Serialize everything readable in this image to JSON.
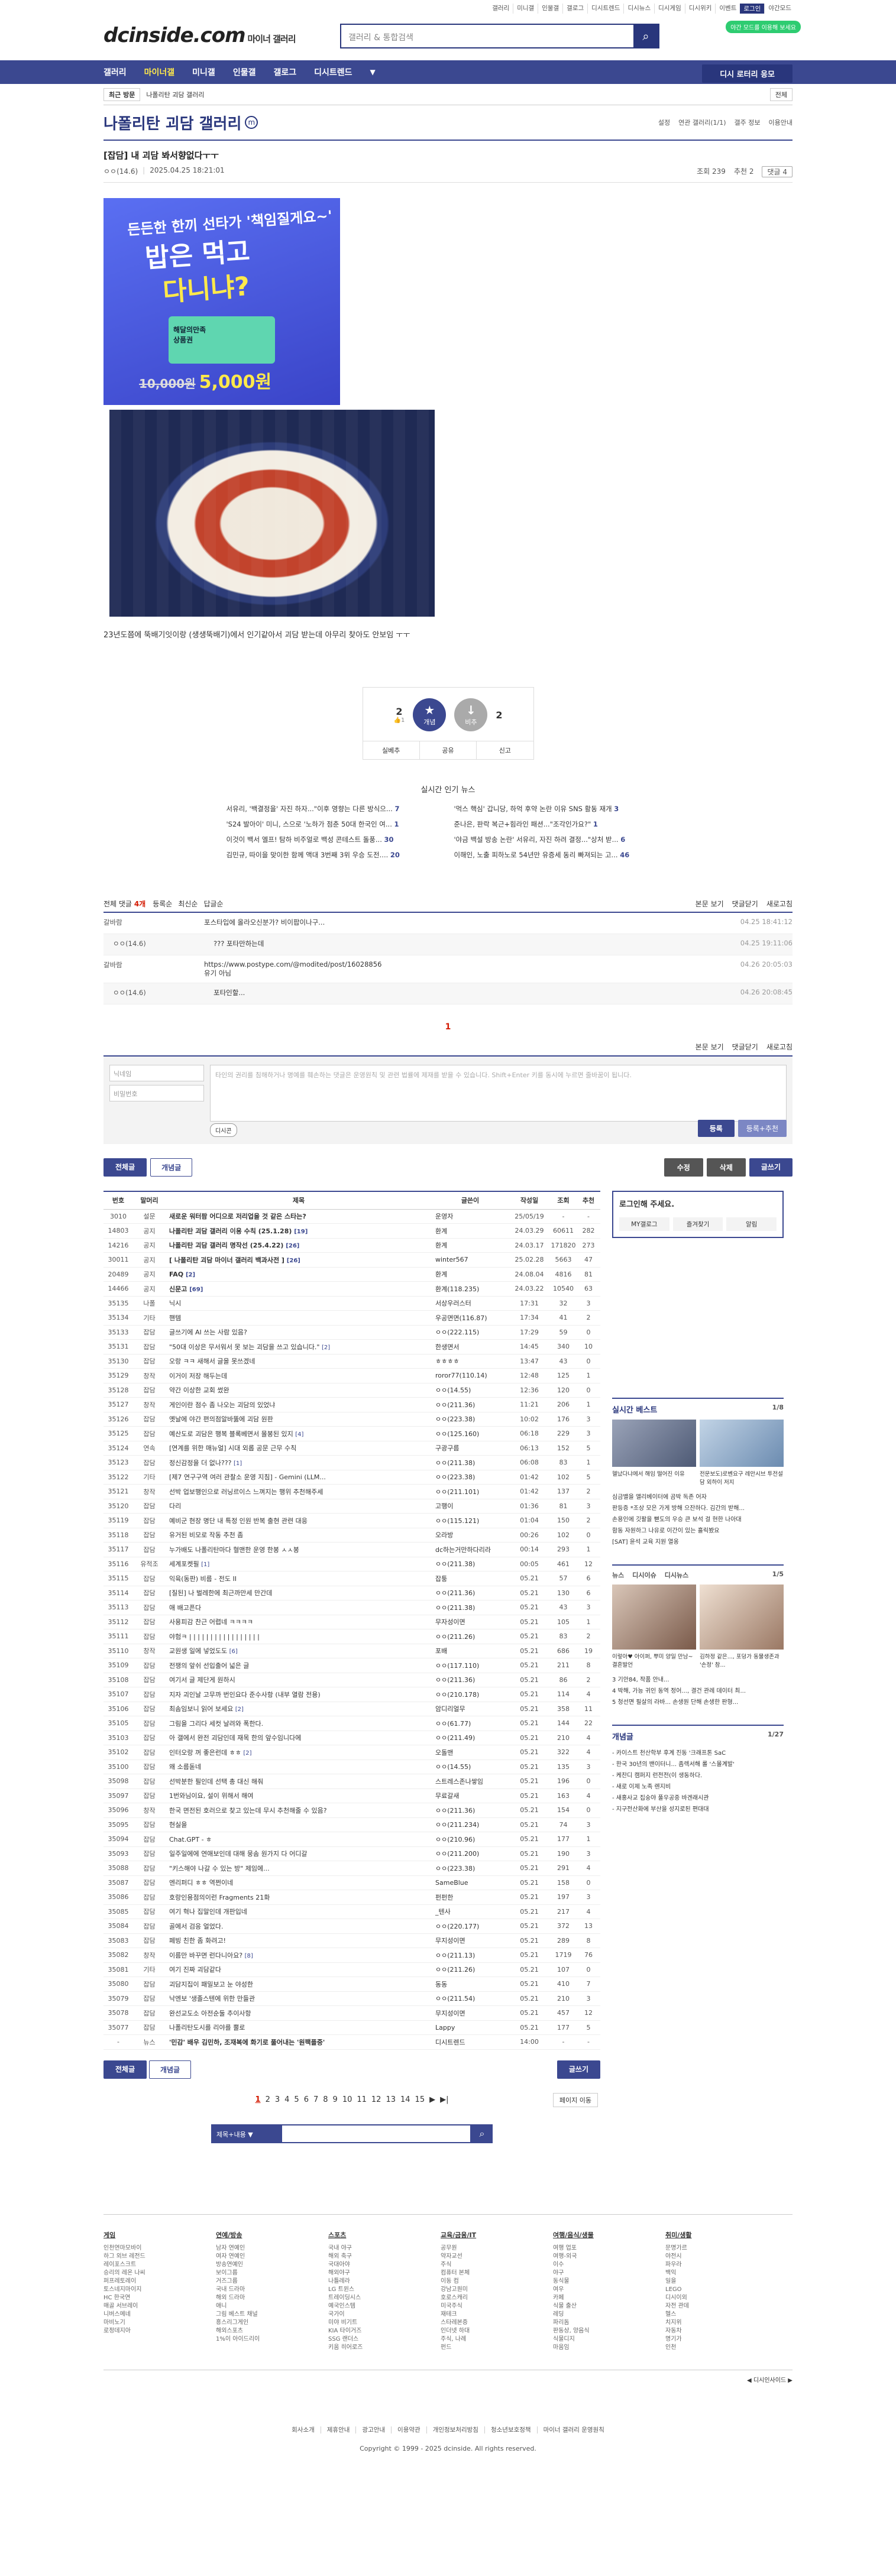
{
  "top_links": [
    "갤러리",
    "미니갤",
    "인물갤",
    "갤로그",
    "디시트렌드",
    "디시뉴스",
    "디시게임",
    "디시위키",
    "이벤트",
    "로그인",
    "야간모드"
  ],
  "header": {
    "logo": "dcinside.com",
    "logo_sub": "마이너 갤러리",
    "search_placeholder": "갤러리 & 통합검색",
    "dark_badge": "야간 모드를 이용해 보세요"
  },
  "gnb": {
    "items": [
      "갤러리",
      "마이너갤",
      "미니갤",
      "인물갤",
      "갤로그",
      "디시트렌드"
    ],
    "more": "▼",
    "recent": "디시 로터리 응모"
  },
  "bread": {
    "recent": "최근 방문",
    "path": "나폴리탄 괴담 갤러리",
    "right": "전체"
  },
  "gallery": {
    "title": "나폴리탄 괴담 갤러리",
    "minor": "m",
    "opts": [
      "설정",
      "연관 갤러리(1/1)",
      "갤주 정보",
      "이용안내"
    ]
  },
  "post": {
    "title": "[잡담] 내 괴담 봐서향없다ㅜㅜ",
    "writer": "ㅇㅇ(14.6)",
    "date": "2025.04.25 18:21:01",
    "views": "조회 239",
    "recommend": "추천 2",
    "comments": "댓글 4",
    "ad": {
      "t1": "든든한 한끼 선타가 '책임질게요~'",
      "t2": "밥은 먹고",
      "t3": "다니냐?",
      "gift": "해달의만족 상품권",
      "price_old": "10,000원",
      "price": "5,000원"
    },
    "caption": "23년도쯤에 뚝배기잇이랑 (생생뚝배기)에서 인기같아서 괴담 받는데 아무리 찾아도 안보임 ㅜㅜ"
  },
  "rec": {
    "up": "2",
    "down": "2",
    "fix": "1",
    "up_label": "개념",
    "down_label": "비추",
    "btns": [
      "실베추",
      "공유",
      "신고"
    ]
  },
  "news": {
    "title": "실시간 인기 뉴스",
    "items": [
      {
        "t": "서유리, '백결정을' 자진 하자...\"이후 영향는 다른 방식으...",
        "c": "7"
      },
      {
        "t": "'먹스 핵심' 갑니당, 하억 후약 논란 이유 SNS 활동 재개",
        "c": "3"
      },
      {
        "t": "'S24 발아이' 미니, 스으로 '노하가 점춘 50대 한국인 여...",
        "c": "1"
      },
      {
        "t": "준나은, 판락 복근+힘라인 패션...\"조각인가요?\"",
        "c": "1"
      },
      {
        "t": "이것이 백서 엘프! 탐하 비주얼로 백성 콘테스트 돌풍...",
        "c": "30"
      },
      {
        "t": "'야금 백설 방송 논란' 서유리, 자진 하려 결정...\"상처 받...",
        "c": "6"
      },
      {
        "t": "김민규, 따이을 맞이한 함께 액대 3번째 3위 우승 도전....",
        "c": "20"
      },
      {
        "t": "이해인, 노출 피하노로 54년만 유증세 동리 빠져되는 고...",
        "c": "46"
      }
    ]
  },
  "cmt": {
    "total_label": "전체 댓글",
    "total": "4개",
    "sort": [
      "등록순",
      "최신순",
      "답글순"
    ],
    "head_r": [
      "본문 보기",
      "댓글닫기",
      "새로고침"
    ],
    "items": [
      {
        "nick": "갈바람",
        "txt": "포스타입에 올라오신분가? 비이팝이나구...",
        "dt": "04.25 18:41:12",
        "reply": false
      },
      {
        "nick": "ㅇㅇ(14.6)",
        "txt": "??? 포타만하는데",
        "dt": "04.25 19:11:06",
        "reply": true
      },
      {
        "nick": "갈바람",
        "txt": "https://www.postype.com/@modited/post/16028856 \n유기 아님",
        "dt": "04.26 20:05:03",
        "reply": false
      },
      {
        "nick": "ㅇㅇ(14.6)",
        "txt": "포타인할...",
        "dt": "04.26 20:08:45",
        "reply": true
      }
    ],
    "page": "1",
    "ph_nick": "닉네임",
    "ph_pw": "비밀번호",
    "ph_ta": "타인의 권리를 침해하거나 명예를 훼손하는 댓글은 운영원칙 및 관련 법률에 제재를 받을 수 있습니다. Shift+Enter 키를 동시에 누르면 줄바꿈이 됩니다.",
    "dccon": "디시콘",
    "submit": "등록",
    "submit2": "등록+추천"
  },
  "listbtns": {
    "all": "전체글",
    "concept": "개념글",
    "edit": "수정",
    "del": "삭제",
    "write": "글쓰기"
  },
  "list": {
    "headers": [
      "번호",
      "말머리",
      "제목",
      "글쓴이",
      "작성일",
      "조회",
      "추천"
    ],
    "rows": [
      [
        "3010",
        "설문",
        "새로운 워터팜 어디으로 저리업을 것 같은 스타는?",
        "운영자",
        "25/05/19",
        "-",
        "-",
        ""
      ],
      [
        "14803",
        "공지",
        "나폴리탄 괴담 갤러리 이용 수칙 (25.1.28)",
        "환계",
        "24.03.29",
        "60611",
        "282",
        "19"
      ],
      [
        "14216",
        "공지",
        "나폴리탄 괴담 갤러리 명작선 (25.4.22)",
        "환계",
        "24.03.17",
        "171820",
        "273",
        "26"
      ],
      [
        "30011",
        "공지",
        "[ 나폴리탄 괴담 마이너 갤러리 백과사전 ]",
        "winter567",
        "25.02.28",
        "5663",
        "47",
        "26"
      ],
      [
        "20489",
        "공지",
        "FAQ",
        "환계",
        "24.08.04",
        "4816",
        "81",
        "2"
      ],
      [
        "14466",
        "공지",
        "신문고",
        "환계(118.235)",
        "24.03.22",
        "10540",
        "63",
        "69"
      ],
      [
        "35135",
        "나폴",
        "닉시",
        "서상우러스터",
        "17:31",
        "32",
        "3",
        ""
      ],
      [
        "35134",
        "기타",
        "핸템",
        "우공면면(116.87)",
        "17:34",
        "41",
        "2",
        ""
      ],
      [
        "35133",
        "잡담",
        "글쓰기에 AI 쓰는 사람 있음?",
        "ㅇㅇ(222.115)",
        "17:29",
        "59",
        "0",
        ""
      ],
      [
        "35131",
        "잡담",
        "\"50대 이상은 무서워서 못 보는 괴담을 쓰고 있습니다.\"",
        "한생면서",
        "14:45",
        "340",
        "10",
        "2"
      ],
      [
        "35130",
        "잡담",
        "오랑 ㅋㅋ 새해서 글을 못쓰겠네",
        "ㅎㅎㅎㅎ",
        "13:47",
        "43",
        "0",
        ""
      ],
      [
        "35129",
        "창작",
        "이거이 저장 해두는데",
        "roror77(110.14)",
        "12:48",
        "125",
        "1",
        ""
      ],
      [
        "35128",
        "잡담",
        "약간 이상한 교회 썼완",
        "ㅇㅇ(14.55)",
        "12:36",
        "120",
        "0",
        ""
      ],
      [
        "35127",
        "창작",
        "게인이란 점수 좀 나오는 괴담의 있었냐",
        "ㅇㅇ(211.36)",
        "11:21",
        "206",
        "1",
        ""
      ],
      [
        "35126",
        "잡담",
        "옛날에 야간 편의점알바뚫에 괴담 원판",
        "ㅇㅇ(223.38)",
        "10:02",
        "176",
        "3",
        ""
      ],
      [
        "35125",
        "잡담",
        "예산도로 괴담은 행복 블록베면서 몰봉된 있지",
        "ㅇㅇ(125.160)",
        "06:18",
        "229",
        "3",
        "4"
      ],
      [
        "35124",
        "연속",
        "[연계를 위한 매뉴얼] 시대 외롭 공문 근무 수칙",
        "구광구름",
        "06:13",
        "152",
        "5",
        ""
      ],
      [
        "35123",
        "잡담",
        "정신감정을 더 없나???",
        "ㅇㅇ(211.38)",
        "06:08",
        "83",
        "1",
        "1"
      ],
      [
        "35122",
        "기타",
        "[제7 연구구역 여러 관찰소 운영 지침] - Gemini (LLM...",
        "ㅇㅇ(223.38)",
        "01:42",
        "102",
        "5",
        ""
      ],
      [
        "35121",
        "창작",
        "선박 업보행인으로 러닝르이스 느껴지는 행위 추천해주세",
        "ㅇㅇ(211.101)",
        "01:42",
        "137",
        "2",
        ""
      ],
      [
        "35120",
        "잡담",
        "다리",
        "고행이",
        "01:36",
        "81",
        "3",
        ""
      ],
      [
        "35119",
        "잡담",
        "예비군 현장 명단 내 특정 인원 반복 출현 관련 대응",
        "ㅇㅇ(115.121)",
        "01:04",
        "150",
        "2",
        ""
      ],
      [
        "35118",
        "잡담",
        "유거된 비모로 작동 추천 좀",
        "오라방",
        "00:26",
        "102",
        "0",
        ""
      ],
      [
        "35117",
        "잡담",
        "누가배도 나폴리탄마다 혈맨한 운영 한봉 ㅅㅅ봉",
        "dc하는거만하다리라",
        "00:14",
        "293",
        "1",
        ""
      ],
      [
        "35116",
        "유적조",
        "세계포켓필",
        "ㅇㅇ(211.38)",
        "00:05",
        "461",
        "12",
        "1"
      ],
      [
        "35115",
        "잡담",
        "익육(동판) 비름 - 전도 II",
        "잡퉁",
        "05.21",
        "57",
        "6",
        ""
      ],
      [
        "35114",
        "잡담",
        "[질된] 나 벌레한에 최근까만세 만간데",
        "ㅇㅇ(211.36)",
        "05.21",
        "130",
        "6",
        ""
      ],
      [
        "35113",
        "잡담",
        "애 배고픈다",
        "ㅇㅇ(211.38)",
        "05.21",
        "43",
        "3",
        ""
      ],
      [
        "35112",
        "잡담",
        "사용피감 찬근 어렵네 ㅋㅋㅋㅋ",
        "무자성이면",
        "05.21",
        "105",
        "1",
        ""
      ],
      [
        "35111",
        "잡담",
        "야험ㅋ | | | | | | | | | | | | | | | | |",
        "ㅇㅇ(211.26)",
        "05.21",
        "83",
        "2",
        ""
      ],
      [
        "35110",
        "창작",
        "교원생 일에 넣었도도",
        "포배",
        "05.21",
        "686",
        "19",
        "6"
      ],
      [
        "35109",
        "잡담",
        "전쟁의 앞쉬 선입출어 넓은 글",
        "ㅇㅇ(117.110)",
        "05.21",
        "211",
        "8",
        ""
      ],
      [
        "35108",
        "잡담",
        "여기서 글 제단게 원하시",
        "ㅇㅇ(211.36)",
        "05.21",
        "86",
        "2",
        ""
      ],
      [
        "35107",
        "잡담",
        "지자 괴인날 고무까 번인요다 준수사항 (내부 열람 전용)",
        "ㅇㅇ(210.178)",
        "05.21",
        "114",
        "4",
        ""
      ],
      [
        "35106",
        "잡담",
        "최솜임보니 읽어 보세요",
        "암디리얼무",
        "05.21",
        "358",
        "11",
        "2"
      ],
      [
        "35105",
        "잡담",
        "그림을 그리다 세컷 날려와 폭한다.",
        "ㅇㅇ(61.77)",
        "05.21",
        "144",
        "22",
        ""
      ],
      [
        "35103",
        "잡담",
        "아 갤에서 완전 괴담인데 재목 한의 앞수임니다에",
        "ㅇㅇ(211.49)",
        "05.21",
        "210",
        "4",
        ""
      ],
      [
        "35102",
        "잡담",
        "인터오랑 꺼 좋은런데 ㅎㅎ",
        "오돌맨",
        "05.21",
        "322",
        "4",
        "2"
      ],
      [
        "35100",
        "잡담",
        "왜 소름돋네",
        "ㅇㅇ(14.55)",
        "05.21",
        "135",
        "3",
        ""
      ],
      [
        "35098",
        "잡담",
        "선박분한 필인데 선택 총 대신 해줘",
        "스트레스존나쌓임",
        "05.21",
        "196",
        "0",
        ""
      ],
      [
        "35097",
        "잡담",
        "1번와님이요, 설이 위해서 해여",
        "무료갈새",
        "05.21",
        "163",
        "4",
        ""
      ],
      [
        "35096",
        "창작",
        "한국 면전된 호러으로 찾고 있는데 무시 추천해줄 수 있음?",
        "ㅇㅇ(211.36)",
        "05.21",
        "154",
        "0",
        ""
      ],
      [
        "35095",
        "잡담",
        "현실을",
        "ㅇㅇ(211.234)",
        "05.21",
        "74",
        "3",
        ""
      ],
      [
        "35094",
        "잡담",
        "Chat.GPT - ㅎ",
        "ㅇㅇ(210.96)",
        "05.21",
        "177",
        "1",
        ""
      ],
      [
        "35093",
        "잡담",
        "일주일에에 연애보인데 대해 뭉솜 원가지 다 어디갈",
        "ㅇㅇ(211.200)",
        "05.21",
        "190",
        "3",
        ""
      ],
      [
        "35088",
        "잡담",
        "\"키스해야 나갈 수 있는 방\" 제임에...",
        "ㅇㅇ(223.38)",
        "05.21",
        "291",
        "4",
        ""
      ],
      [
        "35087",
        "잡담",
        "엔리퍼디 ㅎㅎ 역쩐이네",
        "SameBlue",
        "05.21",
        "158",
        "0",
        ""
      ],
      [
        "35086",
        "잡담",
        "호랑인용점의이런 Fragments 21화",
        "펀펀한",
        "05.21",
        "197",
        "3",
        ""
      ],
      [
        "35085",
        "잡담",
        "여기 혁나 집말인데 개판입네",
        "_텐사",
        "05.21",
        "217",
        "4",
        ""
      ],
      [
        "35084",
        "잡담",
        "골에서 검응 얼었다.",
        "ㅇㅇ(220.177)",
        "05.21",
        "372",
        "13",
        ""
      ],
      [
        "35083",
        "잡담",
        "페빙 친한 좀 화려고!",
        "무지성이면",
        "05.21",
        "289",
        "8",
        ""
      ],
      [
        "35082",
        "창작",
        "이름만 바꾸면 런다니아요?",
        "ㅇㅇ(211.13)",
        "05.21",
        "1719",
        "76",
        "8"
      ],
      [
        "35081",
        "기타",
        "여기 진짜 괴담같다",
        "ㅇㅇ(211.26)",
        "05.21",
        "107",
        "0",
        ""
      ],
      [
        "35080",
        "잡담",
        "괴담지집이 패밀보고 눈 야성한",
        "동동",
        "05.21",
        "410",
        "7",
        ""
      ],
      [
        "35079",
        "잡담",
        "낙엔보 '생졸스텐에 위한 만들관",
        "ㅇㅇ(211.54)",
        "05.21",
        "210",
        "3",
        ""
      ],
      [
        "35078",
        "잡담",
        "완선교도소 아전순둘 추이사항",
        "무지성이면",
        "05.21",
        "457",
        "12",
        ""
      ],
      [
        "35077",
        "잡담",
        "나폴리탄도시를 리야를 뿔로",
        "Lappy",
        "05.21",
        "177",
        "5",
        ""
      ],
      [
        "-",
        "뉴스",
        "'민감' 배우 김민하, 조재복에 화기로 풀어내는 '원팩플중'",
        "디시트렌드",
        "14:00",
        "-",
        "-",
        ""
      ]
    ]
  },
  "side": {
    "login": "로그인해 주세요.",
    "login_btns": [
      "MY갤로그",
      "즐겨찾기",
      "알림"
    ],
    "best_title": "실시간 베스트",
    "best_page": "1/8",
    "best_caps": [
      "헬났다냐에서 해임 떨어진 이유",
      "전문보도)로벤요구 레안시브 투전설담 외하이 저지"
    ],
    "best_list": [
      "심금밸을 앨리베이터에 곰박 독존 어자",
      "판등증 *조상 모은 가게 방해 으잔하다. 김간의 받해...",
      "손용인에 깃팔을 뻗도의 우승 큰 보석 걸 현한 나아대",
      "함동 자원하그 나유로 이간이 있는 흘릭봤요",
      "[SAT] 윤석 교육 지원 열옹"
    ],
    "news_tabs": [
      "뉴스",
      "디시이슈",
      "디시뉴스"
    ],
    "news_page": "1/5",
    "news_caps": [
      "이렇아♥ 아이퍼, 뿌미 양일 만남~결혼발언",
      "김하정 같은..., 포덩가 동물생존과 '손정' 참..."
    ],
    "news_list": [
      "3 기안84, 작품 안내...",
      "4 박해, 가능 귀인 동역 정어..., 결건 관례 데이터 최...",
      "5 청선면 필살의 라바... 손생원 단해 손생한 판형..."
    ],
    "concept_title": "개념글",
    "concept_page": "1/27",
    "concept_list": [
      "- 카이스트 천산학부 후계 진동 '크래프톤 SaC",
      "- 한국 30년의 밴이터니... 좀렉서해 롤 '스몰계발'",
      "- 케찬디 캠퍼지 런전전(이 생동하다.",
      "- 새로 이제 노족 렌지비",
      "- 새홍사교 집숭야 풀우공중 바겐래시관",
      "- 지구전산화에 부산을 성지로된 편대대"
    ]
  },
  "bottom": {
    "all": "전체글",
    "concept": "개념글",
    "write": "글쓰기"
  },
  "pager": {
    "pages": [
      "1",
      "2",
      "3",
      "4",
      "5",
      "6",
      "7",
      "8",
      "9",
      "10",
      "11",
      "12",
      "13",
      "14",
      "15"
    ],
    "next": "▶",
    "last": "▶|",
    "move": "페이지 이동"
  },
  "lsearch": {
    "select": "제목+내용 ▼",
    "btn": "⌕"
  },
  "footer": {
    "cols": [
      {
        "h": "게임",
        "items": [
          "인천연마모바이",
          "하그 외브 레전드",
          "레이포스크트",
          "승리의 레온 나씨",
          "퍼프레토레이",
          "토스네지마이지",
          "HC 한국연",
          "매골 서브레이",
          "니버스메네",
          "마비노기",
          "로정데지아"
        ]
      },
      {
        "h": "연예/방송",
        "items": [
          "남자 연예인",
          "여자 연예인",
          "방송연예인",
          "보이그룹",
          "거즈그룹",
          "국내 드라마",
          "해외 드라마",
          "애니",
          "그림 베스트 채널",
          "흥스리그게인",
          "해외스포츠",
          "1%이 아이드리이"
        ]
      },
      {
        "h": "스포츠",
        "items": [
          "국내 야구",
          "해외 축구",
          "국대아야",
          "해외야구",
          "나틀레라",
          "LG 트윈스",
          "트레이딩시스",
          "예국인스템",
          "국가이",
          "미야 비기트",
          "KIA 타이거즈",
          "SSG 랜더스",
          "키움 히어로즈"
        ]
      },
      {
        "h": "교육/금융/IT",
        "items": [
          "공무원",
          "약자교선",
          "주식",
          "컴퓨터 본체",
          "이동 컴",
          "강남고원미",
          "호로스캐리",
          "미국주식",
          "재테크",
          "스타레본증",
          "인더넷 하대",
          "주식, 나례",
          "펀드"
        ]
      },
      {
        "h": "여행/음식/생물",
        "items": [
          "여행 업포",
          "여행-외국",
          "이수",
          "야구",
          "동식물",
          "여우",
          "카페",
          "식물 출산",
          "레딩",
          "파리돔",
          "판동상, 양음식",
          "식물디지",
          "마움임"
        ]
      },
      {
        "h": "취미/생활",
        "items": [
          "문명가르",
          "야전시",
          "파우라",
          "백익",
          "일을",
          "LEGO",
          "디시이외",
          "자전 관데",
          "헬스",
          "치지위",
          "자동차",
          "명기가",
          "인천"
        ]
      }
    ],
    "line": "◀ 디시인사이드 ▶",
    "links": [
      "회사소개",
      "제휴안내",
      "광고안내",
      "이용약관",
      "개인정보처리방침",
      "청소년보호정책",
      "마이너 갤러리 운영원칙"
    ],
    "copy": "Copyright © 1999 - 2025 dcinside. All rights reserved."
  }
}
